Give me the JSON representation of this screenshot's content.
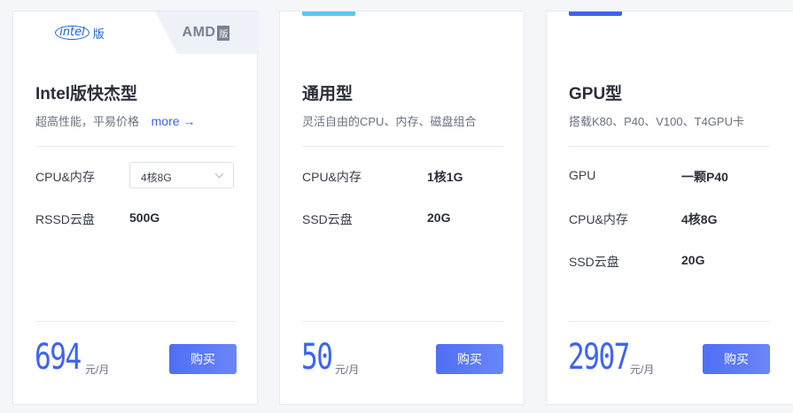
{
  "cards": [
    {
      "tabs": {
        "intel": "intel",
        "intel_suffix": "版",
        "amd": "AMD",
        "amd_suffix": "版"
      },
      "title": "Intel版快杰型",
      "subtitle": "超高性能，平易价格",
      "more": "more →",
      "specs": [
        {
          "label": "CPU&内存",
          "value": "4核8G",
          "type": "select"
        },
        {
          "label": "RSSD云盘",
          "value": "500G"
        }
      ],
      "price": "694",
      "unit": "元/月",
      "buy": "购买"
    },
    {
      "title": "通用型",
      "subtitle": "灵活自由的CPU、内存、磁盘组合",
      "specs": [
        {
          "label": "CPU&内存",
          "value": "1核1G"
        },
        {
          "label": "SSD云盘",
          "value": "20G"
        }
      ],
      "price": "50",
      "unit": "元/月",
      "buy": "购买"
    },
    {
      "title": "GPU型",
      "subtitle": "搭载K80、P40、V100、T4GPU卡",
      "specs": [
        {
          "label": "GPU",
          "value": "一颗P40"
        },
        {
          "label": "CPU&内存",
          "value": "4核8G"
        },
        {
          "label": "SSD云盘",
          "value": "20G"
        }
      ],
      "price": "2907",
      "unit": "元/月",
      "buy": "购买"
    }
  ],
  "colors": {
    "accent": "#3f63f2",
    "accent_light": "#5bc6f2",
    "intel_blue": "#1c63d6"
  }
}
